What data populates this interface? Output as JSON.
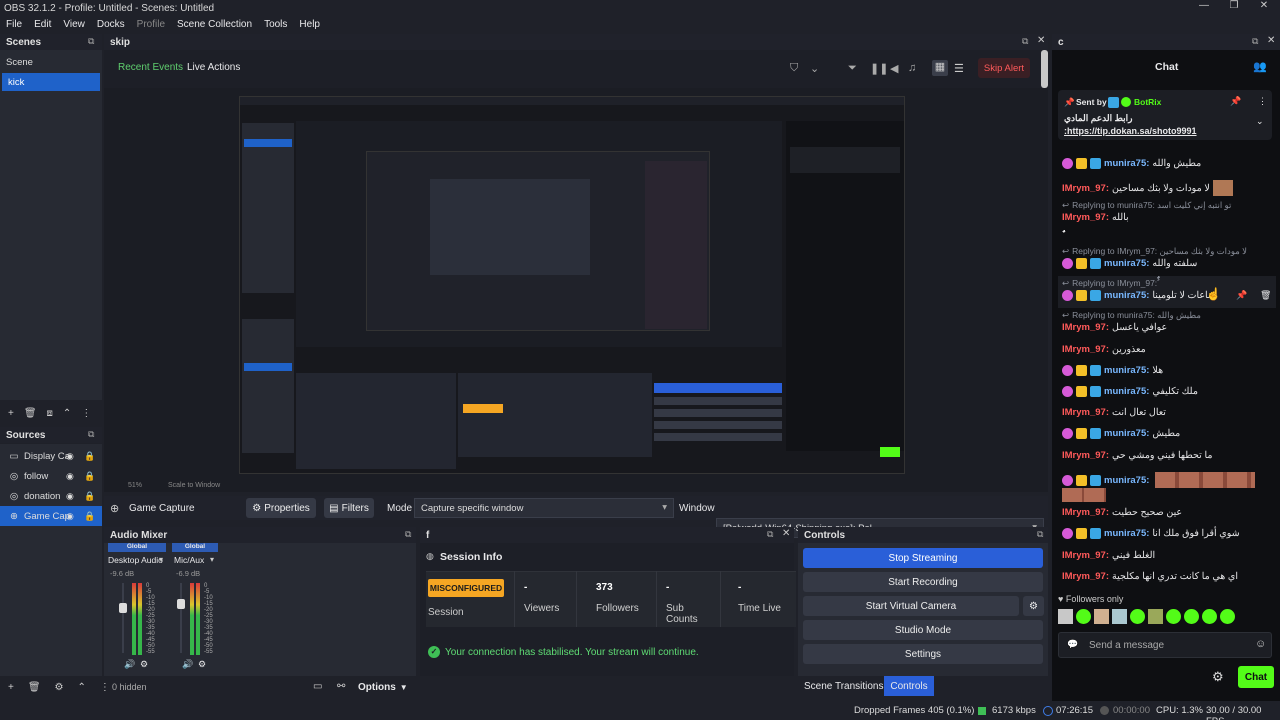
{
  "window": {
    "title": "OBS 32.1.2 - Profile: Untitled - Scenes: Untitled"
  },
  "menu": [
    "File",
    "Edit",
    "View",
    "Docks",
    "Profile",
    "Scene Collection",
    "Tools",
    "Help"
  ],
  "scenes": {
    "title": "Scenes",
    "items": [
      "Scene",
      "kick"
    ],
    "selected": 1
  },
  "sources": {
    "title": "Sources",
    "items": [
      "Display Ca",
      "follow",
      "donation",
      "Game Cap"
    ],
    "selected": 3
  },
  "skip": {
    "title": "skip",
    "tabs": [
      "Recent Events",
      "Live Actions"
    ],
    "skip_alert": "Skip Alert"
  },
  "preview": {
    "zoom": "51%",
    "scale_mode": "Scale to Window"
  },
  "source_bar": {
    "name": "Game Capture",
    "properties": "Properties",
    "filters": "Filters",
    "mode_label": "Mode",
    "mode_value": "Capture specific window",
    "window_label": "Window",
    "window_value": "[Palworld-Win64-Shipping.exe]: Pal"
  },
  "mixer": {
    "title": "Audio Mixer",
    "channels": [
      {
        "tag": "Global",
        "name": "Desktop Audio",
        "db": "-9.6 dB"
      },
      {
        "tag": "Global",
        "name": "Mic/Aux",
        "db": "-6.9 dB"
      }
    ],
    "scale": [
      "0",
      "-5",
      "-10",
      "-15",
      "-20",
      "-25",
      "-30",
      "-35",
      "-40",
      "-45",
      "-50",
      "-55",
      "-60"
    ],
    "hidden": "0 hidden",
    "options": "Options"
  },
  "session": {
    "panel_title": "f",
    "title": "Session Info",
    "status_badge": "MISCONFIGURED",
    "session_label": "Session",
    "stats": [
      {
        "value": "-",
        "label": "Viewers"
      },
      {
        "value": "373",
        "label": "Followers"
      },
      {
        "value": "-",
        "label": "Sub\nCounts"
      },
      {
        "value": "-",
        "label": "Time Live"
      }
    ],
    "message": "Your connection has stabilised. Your stream will continue."
  },
  "controls": {
    "title": "Controls",
    "buttons": [
      "Stop Streaming",
      "Start Recording",
      "Start Virtual Camera",
      "Studio Mode",
      "Settings"
    ],
    "tabs": [
      "Scene Transitions",
      "Controls"
    ]
  },
  "chat": {
    "panel_title": "c",
    "title": "Chat",
    "pinned": {
      "sent_by": "Sent by",
      "bot": "BotRix",
      "text": "رابط الدعم المادي",
      "link": ":https://tip.dokan.sa/shoto9991"
    },
    "lines": [
      {
        "kind": "msg",
        "user": "munira75:",
        "text": "مطيش والله",
        "color": "blue"
      },
      {
        "kind": "msg",
        "user": "IMrym_97:",
        "text": "لا مودات ولا بثك مساحين",
        "color": "red"
      },
      {
        "kind": "reply",
        "text": "Replying to munira75: تو انتبه إني كليت اسد"
      },
      {
        "kind": "msg",
        "user": "IMrym_97:",
        "text": "بالله",
        "color": "red"
      },
      {
        "kind": "plain",
        "text": "ٌٌٌٌٌٌٌٌٌٌٌٌٌٌٌٌٌٌٌٌٌٌٌٌٌٌٌٌٌٌٌٌٌٌٌٌٌٌٌٌ"
      },
      {
        "kind": "reply",
        "text": "Replying to IMrym_97: لا مودات ولا بثك مساحين"
      },
      {
        "kind": "msg",
        "user": "munira75:",
        "text": "سلفته والله",
        "color": "blue"
      },
      {
        "kind": "reply",
        "text": "Replying to IMrym_97: ٌٌٌٌٌٌٌٌٌٌٌٌٌٌٌ"
      },
      {
        "kind": "msg",
        "user": "munira75:",
        "text": "ساعات لا تلومينا",
        "color": "blue"
      },
      {
        "kind": "reply",
        "text": "Replying to munira75: مطيش والله"
      },
      {
        "kind": "msg",
        "user": "IMrym_97:",
        "text": "عوافي ياعسل",
        "color": "red"
      },
      {
        "kind": "msg",
        "user": "IMrym_97:",
        "text": "معذورين",
        "color": "red"
      },
      {
        "kind": "msg",
        "user": "munira75:",
        "text": "هلا",
        "color": "blue"
      },
      {
        "kind": "msg",
        "user": "munira75:",
        "text": "ملك تكليفي",
        "color": "blue"
      },
      {
        "kind": "msg",
        "user": "IMrym_97:",
        "text": "تعال تعال انت",
        "color": "red"
      },
      {
        "kind": "msg",
        "user": "munira75:",
        "text": "مطيش",
        "color": "blue"
      },
      {
        "kind": "msg",
        "user": "IMrym_97:",
        "text": "ما تحطها فيني ومشي حي",
        "color": "red"
      },
      {
        "kind": "msg",
        "user": "munira75:",
        "text": "",
        "color": "blue"
      },
      {
        "kind": "msg",
        "user": "IMrym_97:",
        "text": "عين صحيح حطيت",
        "color": "red"
      },
      {
        "kind": "msg",
        "user": "munira75:",
        "text": "شوي أقرا فوق ملك انا",
        "color": "blue"
      },
      {
        "kind": "msg",
        "user": "IMrym_97:",
        "text": "الغلط فيني",
        "color": "red"
      },
      {
        "kind": "msg",
        "user": "IMrym_97:",
        "text": "اي هي ما كانت تدري انها مكلجية",
        "color": "red"
      }
    ],
    "followers_only": "Followers only",
    "send_placeholder": "Send a message",
    "chat_button": "Chat"
  },
  "statusbar": {
    "dropped": "Dropped Frames 405 (0.1%)",
    "kbps": "6173 kbps",
    "live_time": "07:26:15",
    "rec_time": "00:00:00",
    "cpu": "CPU: 1.3%",
    "fps": "30.00 / 30.00 FPS"
  },
  "colors": {
    "accent": "#1f62c9",
    "live_green": "#53fc18",
    "badge_orange": "#f5a623"
  }
}
